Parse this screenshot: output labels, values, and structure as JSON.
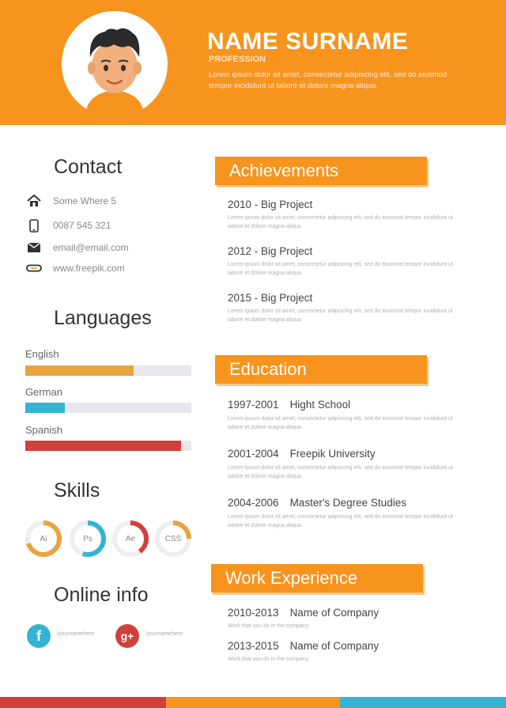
{
  "header": {
    "name": "NAME SURNAME",
    "profession": "PROFESSION",
    "summary": "Lorem ipsum dolor sit amet, consectetur adipiscing elit, sed do eiusmod tempor incididunt ut labore et dolore magna aliqua."
  },
  "contact": {
    "title": "Contact",
    "items": [
      {
        "icon": "home-icon",
        "text": "Some Where 5"
      },
      {
        "icon": "phone-icon",
        "text": "0087 545 321"
      },
      {
        "icon": "mail-icon",
        "text": "email@email.com"
      },
      {
        "icon": "web-icon",
        "text": "www.freepik.com"
      }
    ]
  },
  "languages": {
    "title": "Languages",
    "items": [
      {
        "name": "English",
        "level": 0.65,
        "color": "#e8a33d"
      },
      {
        "name": "German",
        "level": 0.24,
        "color": "#35b3d3"
      },
      {
        "name": "Spanish",
        "level": 0.94,
        "color": "#d2403b"
      }
    ]
  },
  "skills": {
    "title": "Skills",
    "items": [
      {
        "label": "Ai",
        "level": 0.7,
        "color": "#e8a33d"
      },
      {
        "label": "Ps",
        "level": 0.55,
        "color": "#35b3d3"
      },
      {
        "label": "Ae",
        "level": 0.4,
        "color": "#d2403b"
      },
      {
        "label": "CSS",
        "level": 0.25,
        "color": "#e8a33d"
      }
    ]
  },
  "online": {
    "title": "Online info",
    "facebook": {
      "glyph": "f",
      "handle": "/yournamehere",
      "color": "#35b3d3"
    },
    "google": {
      "glyph": "g+",
      "handle": "/yournamehere",
      "color": "#d2403b"
    }
  },
  "achievements": {
    "title": "Achievements",
    "items": [
      {
        "heading": "2010 - Big Project",
        "desc": "Lorem ipsum dolor sit amet, consectetur adipiscing elit, sed do eiusmod tempor incididunt ut labore et dolore magna aliqua."
      },
      {
        "heading": "2012 - Big Project",
        "desc": "Lorem ipsum dolor sit amet, consectetur adipiscing elit, sed do eiusmod tempor incididunt ut labore et dolore magna aliqua."
      },
      {
        "heading": "2015 - Big Project",
        "desc": "Lorem ipsum dolor sit amet, consectetur adipiscing elit, sed do eiusmod tempor incididunt ut labore et dolore magna aliqua."
      }
    ]
  },
  "education": {
    "title": "Education",
    "items": [
      {
        "years": "1997-2001",
        "school": "Hight School",
        "desc": "Lorem ipsum dolor sit amet, consectetur adipiscing elit, sed do eiusmod tempor incididunt ut labore et dolore magna aliqua."
      },
      {
        "years": "2001-2004",
        "school": "Freepik University",
        "desc": "Lorem ipsum dolor sit amet, consectetur adipiscing elit, sed do eiusmod tempor incididunt ut labore et dolore magna aliqua."
      },
      {
        "years": "2004-2006",
        "school": "Master's Degree Studies",
        "desc": "Lorem ipsum dolor sit amet, consectetur adipiscing elit, sed do eiusmod tempor incididunt ut labore et dolore magna aliqua."
      }
    ]
  },
  "work": {
    "title": "Work Experience",
    "items": [
      {
        "years": "2010-2013",
        "company": "Name of Company",
        "desc": "Work that you do in the company"
      },
      {
        "years": "2013-2015",
        "company": "Name of Company",
        "desc": "Work that you do in the company"
      }
    ]
  },
  "colors": {
    "accent": "#f7941d",
    "footer_stripes": [
      "#d2403b",
      "#f7941d",
      "#35b3d3"
    ]
  }
}
